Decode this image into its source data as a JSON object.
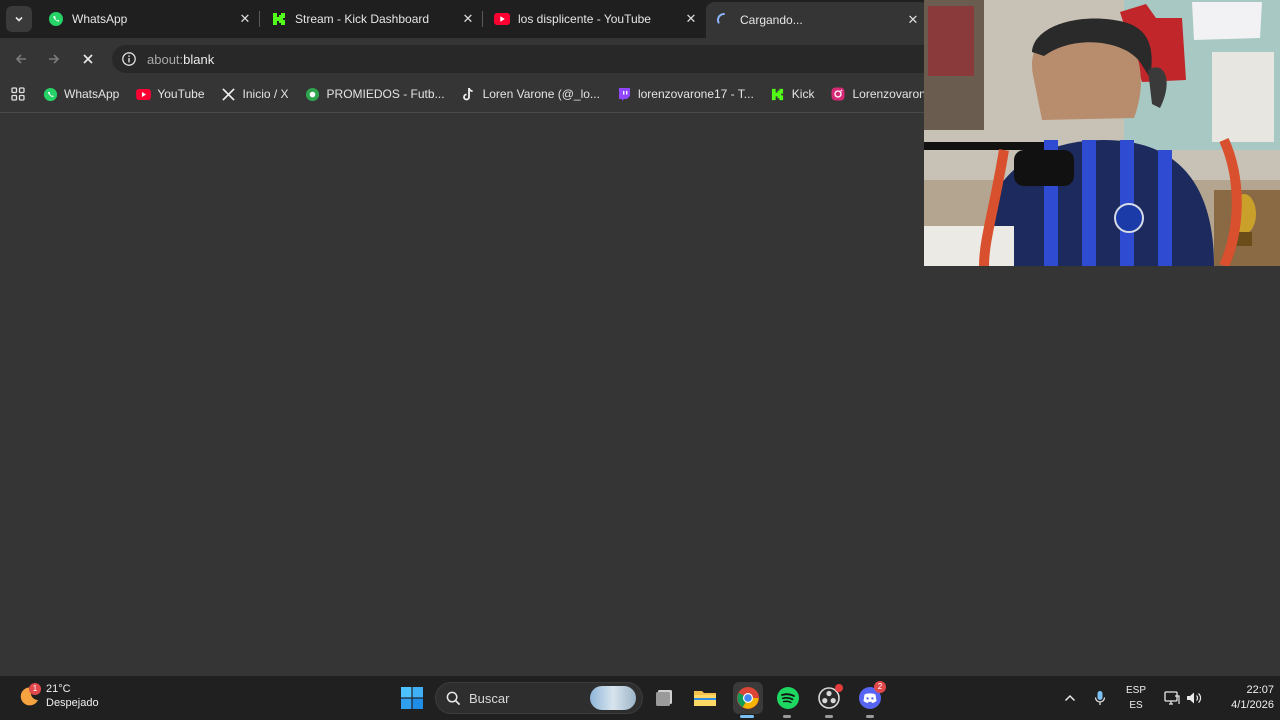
{
  "browser": {
    "tabs": [
      {
        "title": "WhatsApp",
        "icon": "whatsapp-icon",
        "active": false
      },
      {
        "title": "Stream - Kick Dashboard",
        "icon": "kick-icon",
        "active": false
      },
      {
        "title": "los displicente - YouTube",
        "icon": "youtube-icon",
        "active": false
      },
      {
        "title": "Cargando...",
        "icon": "loading-spinner-icon",
        "active": true
      }
    ],
    "address": {
      "scheme": "about:",
      "host": "blank"
    },
    "bookmarks": [
      {
        "label": "WhatsApp",
        "icon": "whatsapp-icon"
      },
      {
        "label": "YouTube",
        "icon": "youtube-icon"
      },
      {
        "label": "Inicio / X",
        "icon": "x-icon"
      },
      {
        "label": "PROMIEDOS - Futb...",
        "icon": "promiedos-icon"
      },
      {
        "label": "Loren Varone (@_lo...",
        "icon": "tiktok-icon"
      },
      {
        "label": "lorenzovarone17 - T...",
        "icon": "twitch-icon"
      },
      {
        "label": "Kick",
        "icon": "kick-icon"
      },
      {
        "label": "Lorenzovarone (Inst...",
        "icon": "instagram-icon"
      }
    ]
  },
  "taskbar": {
    "weather": {
      "temp": "21°C",
      "condition": "Despejado",
      "badge": "1"
    },
    "search_label": "Buscar",
    "discord_badge": "2",
    "lang": {
      "line1": "ESP",
      "line2": "ES"
    },
    "clock": {
      "time": "22:07",
      "date": "4/1/2026"
    }
  },
  "colors": {
    "page_bg": "#353535",
    "tabstrip_bg": "#1f1f1f",
    "taskbar_bg": "#202020",
    "whatsapp": "#25d366",
    "kick": "#53fc18",
    "youtube": "#ff0033",
    "twitch": "#9146ff",
    "spotify": "#1ed760",
    "discord": "#5865f2"
  }
}
